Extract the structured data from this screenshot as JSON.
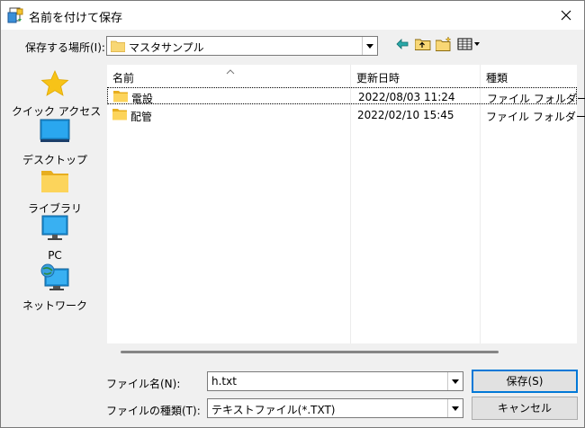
{
  "window": {
    "title": "名前を付けて保存"
  },
  "location": {
    "label": "保存する場所(I):",
    "value": "マスタサンプル"
  },
  "places": [
    {
      "icon": "star-icon",
      "label": "クイック アクセス"
    },
    {
      "icon": "desktop-icon",
      "label": "デスクトップ"
    },
    {
      "icon": "library-icon",
      "label": "ライブラリ"
    },
    {
      "icon": "pc-icon",
      "label": "PC"
    },
    {
      "icon": "network-icon",
      "label": "ネットワーク"
    }
  ],
  "columns": [
    "名前",
    "更新日時",
    "種類"
  ],
  "files": [
    {
      "name": "電設",
      "modified": "2022/08/03 11:24",
      "type": "ファイル フォルダー"
    },
    {
      "name": "配管",
      "modified": "2022/02/10 15:45",
      "type": "ファイル フォルダー"
    }
  ],
  "filename": {
    "label": "ファイル名(N):",
    "value": "h.txt"
  },
  "filetype": {
    "label": "ファイルの種類(T):",
    "value": "テキストファイル(*.TXT)"
  },
  "buttons": {
    "save": "保存(S)",
    "cancel": "キャンセル"
  },
  "colors": {
    "accent": "#0078d7",
    "folder": "#f8d775"
  }
}
